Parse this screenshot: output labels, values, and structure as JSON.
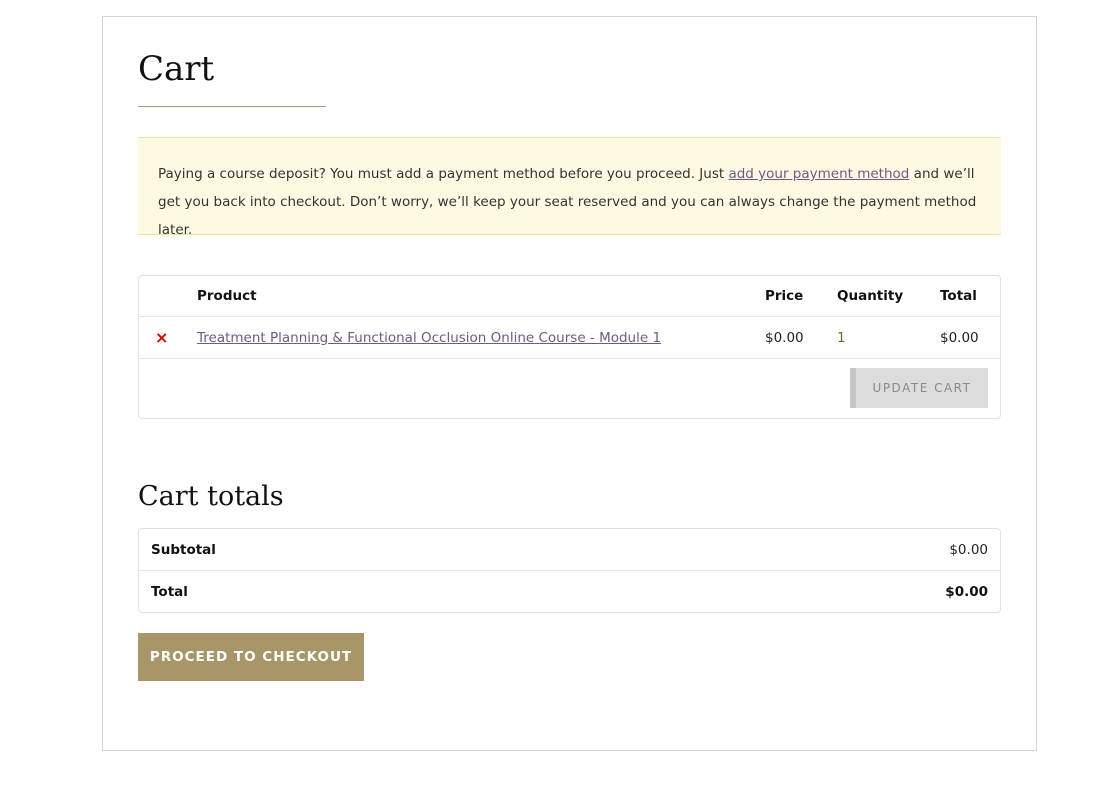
{
  "page_title": "Cart",
  "notice": {
    "before": "Paying a course deposit? You must add a payment method before you proceed. Just ",
    "link": "add your payment method",
    "after": " and we’ll get you back into checkout. Don’t worry, we’ll keep your seat reserved and you can always change the payment method later."
  },
  "cart_table": {
    "headers": {
      "product": "Product",
      "price": "Price",
      "quantity": "Quantity",
      "total": "Total"
    },
    "items": [
      {
        "remove": "×",
        "product": "Treatment Planning & Functional Occlusion Online Course - Module 1",
        "price": "$0.00",
        "quantity": "1",
        "total": "$0.00"
      }
    ],
    "update_label": "UPDATE CART"
  },
  "totals": {
    "title": "Cart totals",
    "subtotal_label": "Subtotal",
    "subtotal": "$0.00",
    "total_label": "Total",
    "total": "$0.00"
  },
  "checkout_label": "PROCEED TO CHECKOUT"
}
